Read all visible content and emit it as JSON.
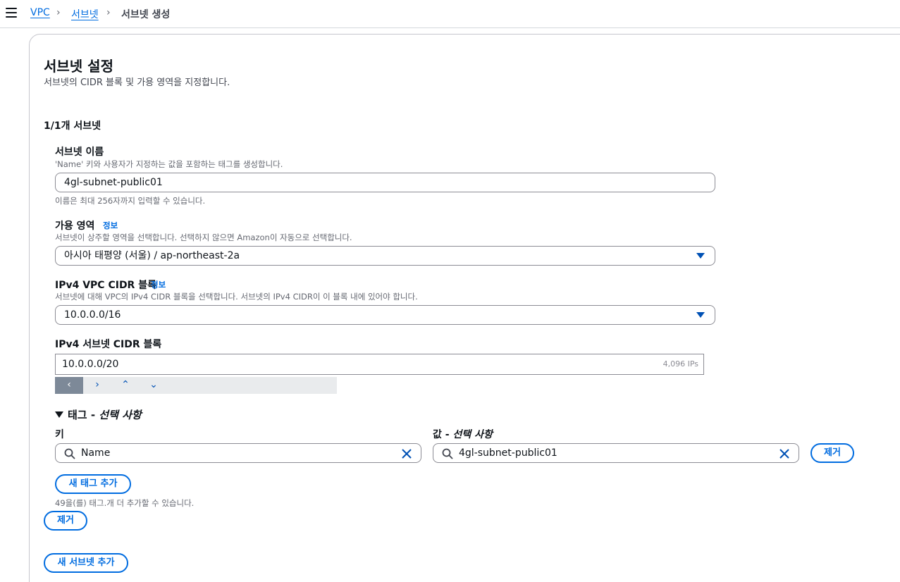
{
  "breadcrumb": {
    "vpc": "VPC",
    "subnets": "서브넷",
    "current": "서브넷 생성"
  },
  "section": {
    "title": "서브넷 설정",
    "description": "서브넷의 CIDR 블록 및 가용 영역을 지정합니다."
  },
  "subnet_count": "1/1개 서브넷",
  "subnet_name": {
    "label": "서브넷 이름",
    "description": "'Name' 키와 사용자가 지정하는 값을 포함하는 태그를 생성합니다.",
    "value": "4gl-subnet-public01",
    "constraint": "이름은 최대 256자까지 입력할 수 있습니다."
  },
  "availability_zone": {
    "label": "가용 영역",
    "info": "정보",
    "description": "서브넷이 상주할 영역을 선택합니다. 선택하지 않으면 Amazon이 자동으로 선택합니다.",
    "value": "아시아 태평양 (서울) / ap-northeast-2a"
  },
  "ipv4_vpc_cidr": {
    "label": "IPv4 VPC CIDR 블록",
    "info": "정보",
    "description": "서브넷에 대해 VPC의 IPv4 CIDR 블록을 선택합니다. 서브넷의 IPv4 CIDR이 이 블록 내에 있어야 합니다.",
    "value": "10.0.0.0/16"
  },
  "ipv4_subnet_cidr": {
    "label": "IPv4 서브넷 CIDR 블록",
    "value": "10.0.0.0/20",
    "ips": "4,096 IPs",
    "stepper": {
      "prev": "‹",
      "next": "›",
      "up": "⌃",
      "down": "⌄"
    }
  },
  "tags": {
    "heading_main": "태그 - ",
    "heading_italic": "선택 사항",
    "key_label": "키",
    "value_label_main": "값 - ",
    "value_label_italic": "선택 사항",
    "key_value": "Name",
    "value_value": "4gl-subnet-public01",
    "remove_label": "제거",
    "add_label": "새 태그 추가",
    "remaining": "49을(를) 태그.개 더 추가할 수 있습니다."
  },
  "remove_subnet_label": "제거",
  "add_subnet_label": "새 서브넷 추가",
  "colors": {
    "link": "#006ce0",
    "border": "#8c8c94",
    "stepper_active": "#7d8998"
  },
  "icons": {
    "menu": "hamburger-icon",
    "search": "search-icon",
    "clear": "close-icon",
    "dropdown": "caret-down-icon"
  }
}
